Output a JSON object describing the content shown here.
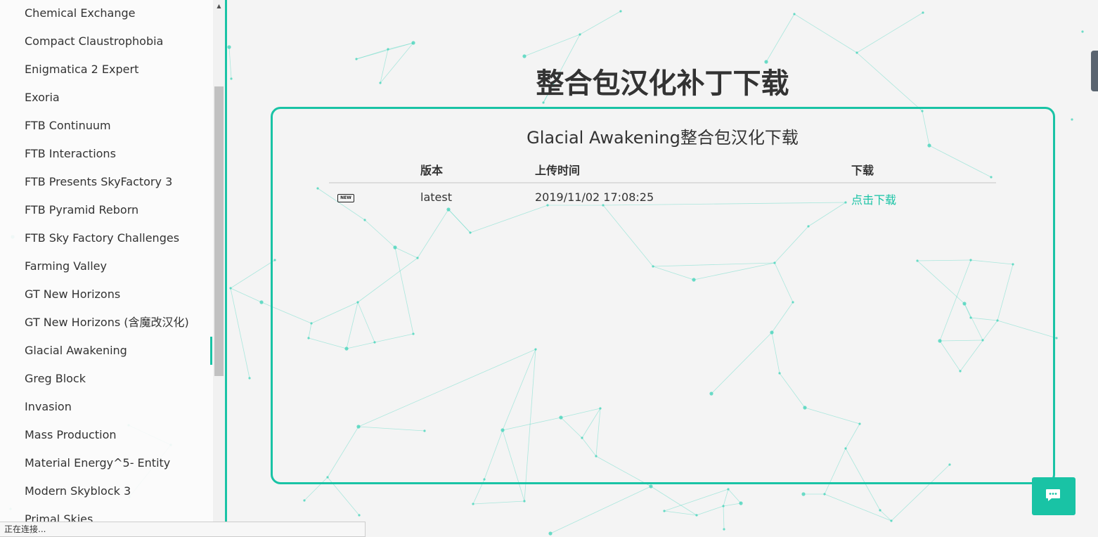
{
  "sidebar": {
    "items": [
      "Chemical Exchange",
      "Compact Claustrophobia",
      "Enigmatica 2 Expert",
      "Exoria",
      "FTB Continuum",
      "FTB Interactions",
      "FTB Presents SkyFactory 3",
      "FTB Pyramid Reborn",
      "FTB Sky Factory Challenges",
      "Farming Valley",
      "GT New Horizons",
      "GT New Horizons (含魔改汉化)",
      "Glacial Awakening",
      "Greg Block",
      "Invasion",
      "Mass Production",
      "Material Energy^5- Entity",
      "Modern Skyblock 3",
      "Primal Skies"
    ],
    "active": "Glacial Awakening"
  },
  "main": {
    "title": "整合包汉化补丁下载",
    "card_title": "Glacial Awakening整合包汉化下载",
    "table": {
      "headers": [
        "版本",
        "上传时间",
        "下载"
      ],
      "rows": [
        {
          "badge": "NEW",
          "version": "latest",
          "upload_time": "2019/11/02 17:08:25",
          "download": "点击下载"
        }
      ]
    }
  },
  "status_bar": "正在连接...",
  "colors": {
    "accent": "#19c3a5",
    "background": "#f4f4f4",
    "text": "#333333"
  },
  "icons": {
    "chat": "chat-bubble-icon",
    "scroll_up": "triangle-up-icon"
  }
}
